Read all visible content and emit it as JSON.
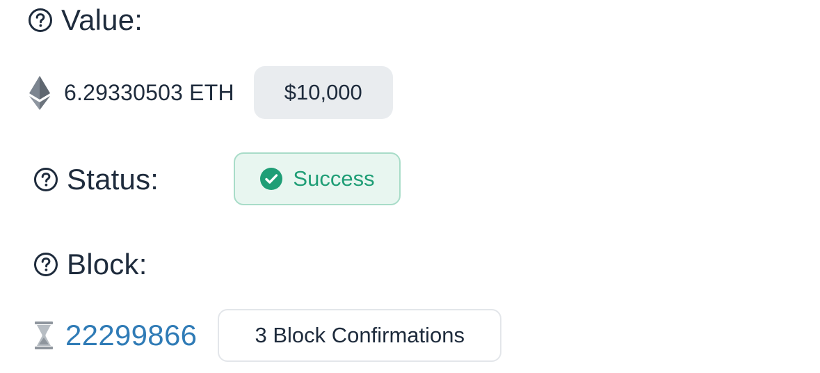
{
  "value": {
    "label": "Value:",
    "help_icon": "question-circle-icon",
    "currency_icon": "ethereum-icon",
    "amount": "6.29330503 ETH",
    "usd": "$10,000"
  },
  "status": {
    "label": "Status:",
    "help_icon": "question-circle-icon",
    "badge_icon": "check-circle-icon",
    "badge_text": "Success",
    "colors": {
      "success_text": "#1f9e76",
      "success_bg": "#e8f6f0",
      "success_border": "#a8dcc8"
    }
  },
  "block": {
    "label": "Block:",
    "help_icon": "question-circle-icon",
    "pending_icon": "hourglass-icon",
    "number": "22299866",
    "confirmations": "3 Block Confirmations",
    "link_color": "#2f7bb6"
  }
}
